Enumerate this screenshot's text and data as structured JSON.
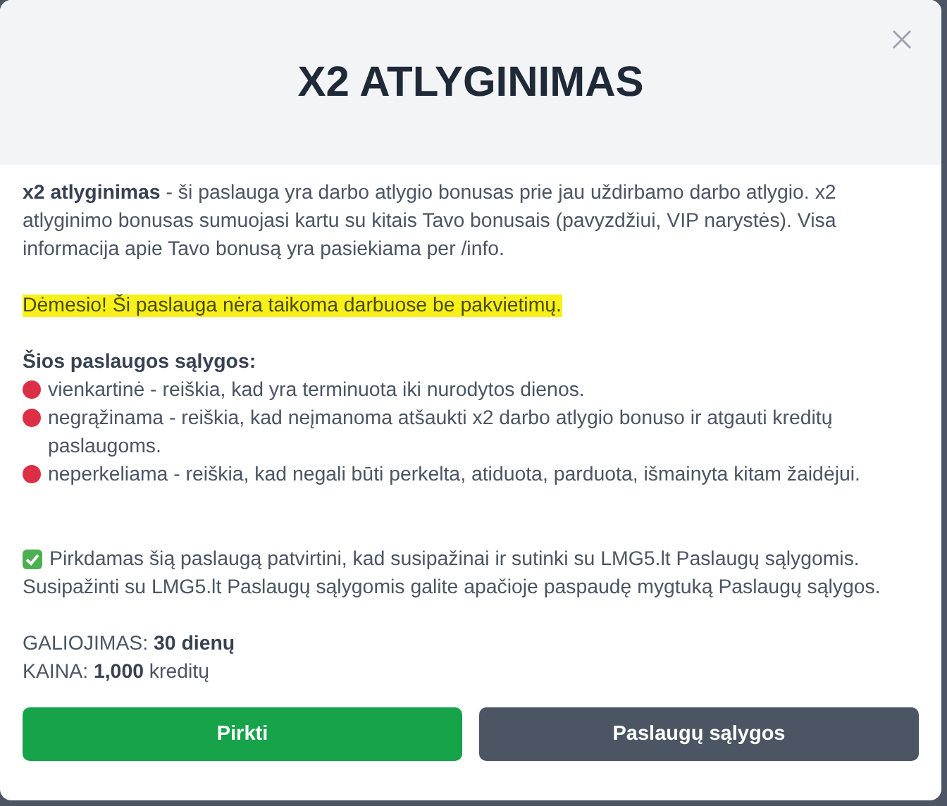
{
  "title": "X2 ATLYGINIMAS",
  "intro": "**x2 atlyginimas** - ši paslauga yra darbo atlygio bonusas prie jau uždirbamo darbo atlygio. x2 atlyginimo bonusas sumuojasi kartu su kitais Tavo bonusais (pavyzdžiui, VIP narystės). Visa informacija apie Tavo bonusą yra pasiekiama per /info.",
  "notice": {
    "text": "Dėmesio! Ši paslauga nėra taikoma darbuose be pakvietimų.",
    "highlighted": true
  },
  "conditions": {
    "heading": "Šios paslaugos sąlygos:",
    "items": [
      {
        "text": "vienkartinė - reiškia, kad yra terminuota iki nurodytos dienos.",
        "color": "#dc2f45"
      },
      {
        "text": "negrąžinama - reiškia, kad neįmanoma atšaukti x2 darbo atlygio bonuso ir atgauti kreditų paslaugoms.",
        "color": "#dc2f45"
      },
      {
        "text": "neperkeliama - reiškia, kad negali būti perkelta, atiduota, parduota, išmainyta kitam žaidėjui.",
        "color": "#dc2f45"
      }
    ]
  },
  "agreement": {
    "checked": true,
    "lines": [
      "Pirkdamas šią paslaugą patvirtini, kad susipažinai ir sutinki su LMG5.lt Paslaugų sąlygomis.",
      "Susipažinti su LMG5.lt Paslaugų sąlygomis galite apačioje paspaudę mygtuką Paslaugų sąlygos."
    ]
  },
  "details": [
    "GALIOJIMAS: **30 dienų**",
    "KAINA: **1,000** kreditų"
  ],
  "buttons": [
    {
      "label": "Pirkti",
      "kind": "primary"
    },
    {
      "label": "Paslaugų sąlygos",
      "kind": "secondary"
    }
  ]
}
